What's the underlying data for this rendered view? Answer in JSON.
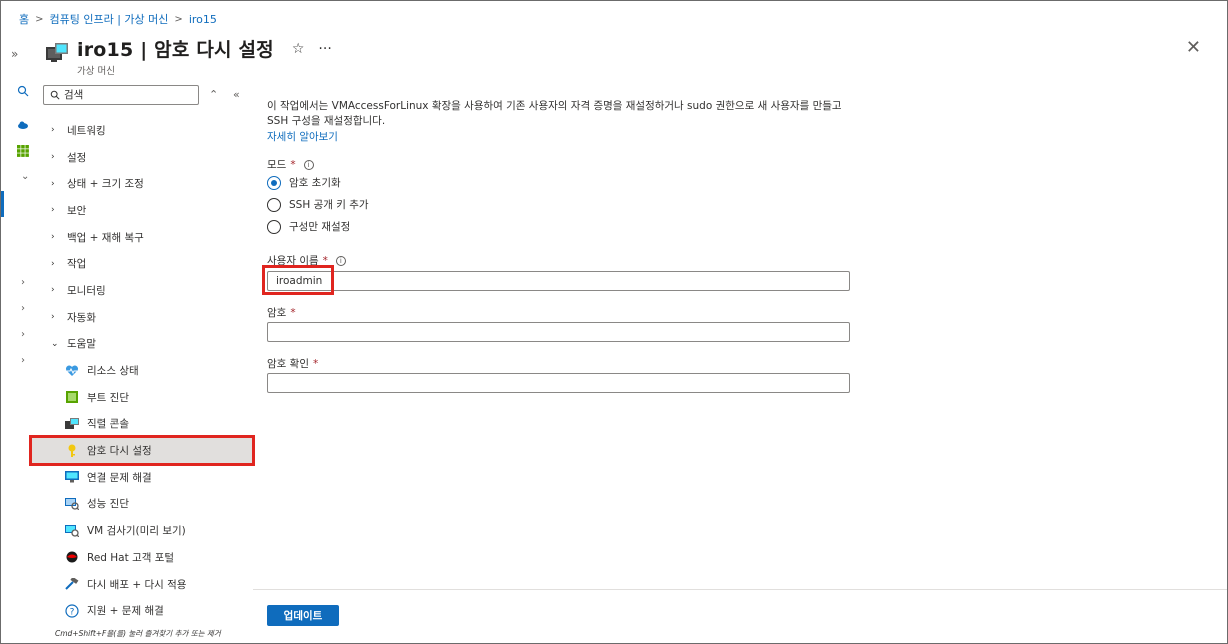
{
  "breadcrumb": [
    "홈",
    "컴퓨팅 인프라 | 가상 머신",
    "iro15"
  ],
  "header": {
    "title": "iro15 | 암호 다시 설정",
    "subtitle": "가상 머신"
  },
  "sidemenu": {
    "search_placeholder": "검색",
    "items": [
      {
        "label": "네트워킹",
        "expanded": false
      },
      {
        "label": "설정",
        "expanded": false
      },
      {
        "label": "상태 + 크기 조정",
        "expanded": false
      },
      {
        "label": "보안",
        "expanded": false
      },
      {
        "label": "백업 + 재해 복구",
        "expanded": false
      },
      {
        "label": "작업",
        "expanded": false
      },
      {
        "label": "모니터링",
        "expanded": false
      },
      {
        "label": "자동화",
        "expanded": false
      },
      {
        "label": "도움말",
        "expanded": true
      }
    ],
    "help_items": [
      {
        "label": "리소스 상태",
        "icon": "heart-pulse-icon"
      },
      {
        "label": "부트 진단",
        "icon": "boot-diagnostics-icon"
      },
      {
        "label": "직렬 콘솔",
        "icon": "serial-console-icon"
      },
      {
        "label": "암호 다시 설정",
        "icon": "key-icon",
        "active": true
      },
      {
        "label": "연결 문제 해결",
        "icon": "monitor-icon"
      },
      {
        "label": "성능 진단",
        "icon": "performance-icon"
      },
      {
        "label": "VM 검사기(미리 보기)",
        "icon": "vm-inspector-icon"
      },
      {
        "label": "Red Hat 고객 포털",
        "icon": "redhat-icon"
      },
      {
        "label": "다시 배포 + 다시 적용",
        "icon": "hammer-icon"
      },
      {
        "label": "지원 + 문제 해결",
        "icon": "question-icon"
      }
    ],
    "hint": "Cmd+Shift+F을(를) 눌러 즐겨찾기 추가 또는 제거"
  },
  "content": {
    "description": "이 작업에서는 VMAccessForLinux 확장을 사용하여 기존 사용자의 자격 증명을 재설정하거나 sudo 권한으로 새 사용자를 만들고 SSH 구성을 재설정합니다.",
    "learn_more": "자세히 알아보기",
    "mode_label": "모드",
    "mode_options": [
      {
        "label": "암호 초기화",
        "checked": true
      },
      {
        "label": "SSH 공개 키 추가",
        "checked": false
      },
      {
        "label": "구성만 재설정",
        "checked": false
      }
    ],
    "username_label": "사용자 이름",
    "username_value": "iroadmin",
    "password_label": "암호",
    "password_value": "",
    "confirm_label": "암호 확인",
    "confirm_value": "",
    "update_button": "업데이트"
  },
  "colors": {
    "accent": "#0f6cbd",
    "highlight": "#e0251f",
    "required": "#a4262c"
  }
}
